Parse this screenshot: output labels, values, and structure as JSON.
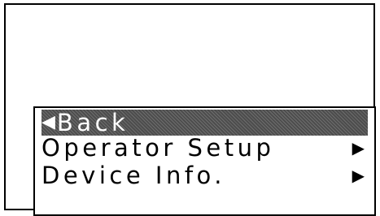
{
  "menu": {
    "items": [
      {
        "label": "Back",
        "icon": "back-arrow-icon",
        "glyph": "◀",
        "selected": true
      },
      {
        "label": "Operator Setup",
        "icon": "submenu-arrow-icon",
        "glyph": "▶",
        "selected": false
      },
      {
        "label": "Device Info.",
        "icon": "submenu-arrow-icon",
        "glyph": "▶",
        "selected": false
      }
    ]
  },
  "colors": {
    "background": "#ffffff",
    "foreground": "#000000",
    "selection": "#4d4d4d"
  }
}
